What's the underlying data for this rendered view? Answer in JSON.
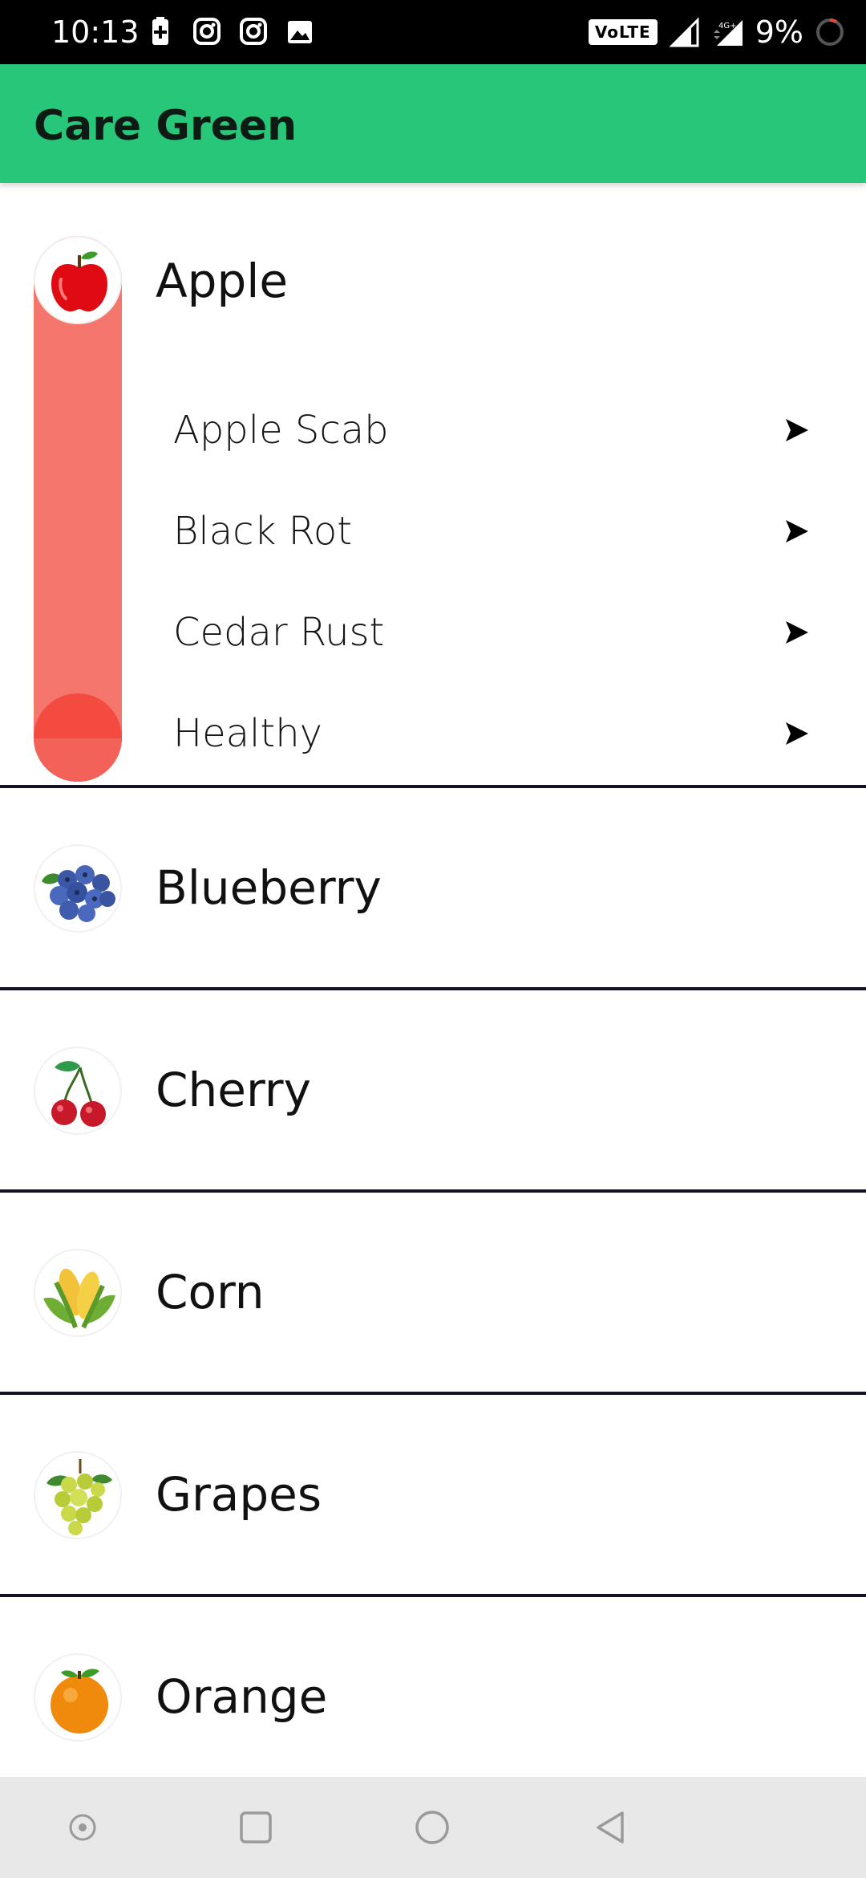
{
  "status_bar": {
    "time": "10:13",
    "network": "VoLTE",
    "network_gen": "4G+",
    "battery": "9%"
  },
  "app_bar": {
    "title": "Care Green"
  },
  "crops": [
    {
      "name": "Apple",
      "icon": "apple-icon",
      "expanded": true,
      "diseases": [
        "Apple Scab",
        "Black Rot",
        "Cedar Rust",
        "Healthy"
      ]
    },
    {
      "name": "Blueberry",
      "icon": "blueberry-icon",
      "expanded": false
    },
    {
      "name": "Cherry",
      "icon": "cherry-icon",
      "expanded": false
    },
    {
      "name": "Corn",
      "icon": "corn-icon",
      "expanded": false
    },
    {
      "name": "Grapes",
      "icon": "grapes-icon",
      "expanded": false
    },
    {
      "name": "Orange",
      "icon": "orange-icon",
      "expanded": false
    }
  ],
  "colors": {
    "app_bar": "#28c679",
    "expanded_indicator": "#f4766c",
    "divider": "#141226",
    "nav_bar": "#e8e8e8"
  },
  "nav_bar": {
    "buttons": [
      "assist-icon",
      "recents-icon",
      "home-icon",
      "back-icon"
    ]
  }
}
